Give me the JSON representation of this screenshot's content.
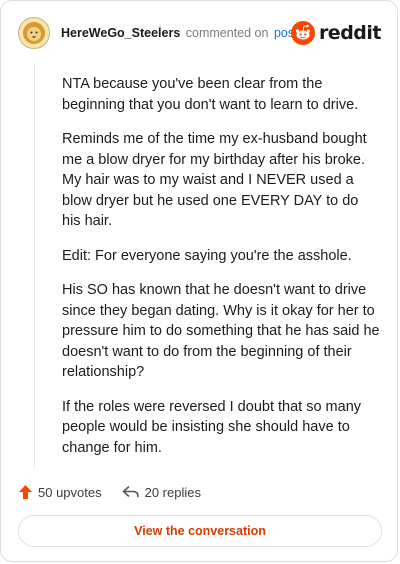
{
  "comment": {
    "username": "HereWeGo_Steelers",
    "verb": "commented on",
    "post_link": "post",
    "paragraphs": [
      "NTA because you've been clear from the beginning that you don't want to learn to drive.",
      "Reminds me of the time my ex-husband bought me a blow dryer for my birthday after his broke. My hair was to my waist and I NEVER used a blow dryer but he used one EVERY DAY to do his hair.",
      "Edit: For everyone saying you're the asshole.",
      "His SO has known that he doesn't want to drive since they began dating. Why is it okay for her to pressure him to do something that he has said he doesn't want to do from the beginning of their relationship?",
      "If the roles were reversed I doubt that so many people would be insisting she should have to change for him."
    ]
  },
  "brand": {
    "wordmark": "reddit",
    "icon": "reddit-snoo-icon",
    "color": "#ff4500"
  },
  "footer": {
    "upvotes": "50 upvotes",
    "replies": "20 replies",
    "upvote_icon": "upvote-arrow-icon",
    "reply_icon": "reply-arrow-icon",
    "upvote_color": "#ff4500"
  },
  "cta": {
    "label": "View the conversation",
    "color": "#d93a00"
  }
}
